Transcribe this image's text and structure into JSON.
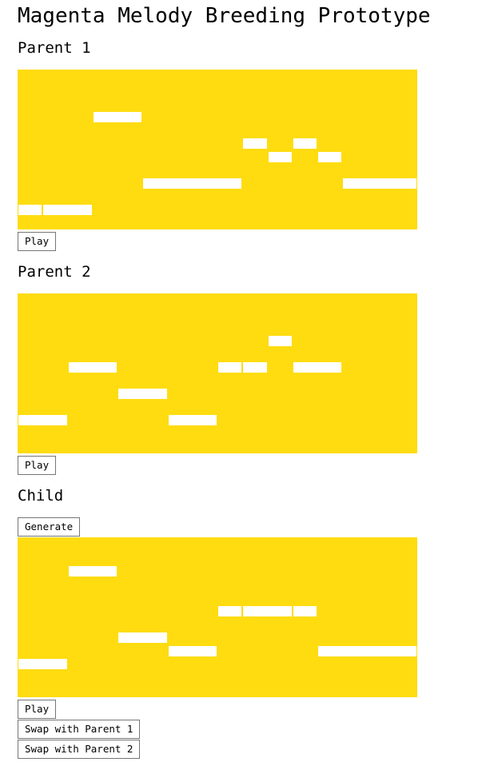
{
  "page": {
    "title": "Magenta Melody Breeding Prototype"
  },
  "sections": {
    "parent1": {
      "heading": "Parent 1",
      "play_label": "Play"
    },
    "parent2": {
      "heading": "Parent 2",
      "play_label": "Play"
    },
    "child": {
      "heading": "Child",
      "generate_label": "Generate",
      "play_label": "Play",
      "swap1_label": "Swap with Parent 1",
      "swap2_label": "Swap with Parent 2"
    }
  },
  "colors": {
    "roll_background": "#fedc10",
    "note": "#ffffff"
  },
  "melodies": {
    "note_grid": {
      "steps": 16,
      "lowest_pitch_row": 11
    },
    "parent1": [
      {
        "start": 0,
        "duration": 1,
        "row": 0
      },
      {
        "start": 1,
        "duration": 2,
        "row": 0
      },
      {
        "start": 3,
        "duration": 2,
        "row": 7
      },
      {
        "start": 5,
        "duration": 4,
        "row": 2
      },
      {
        "start": 9,
        "duration": 1,
        "row": 5
      },
      {
        "start": 10,
        "duration": 1,
        "row": 4
      },
      {
        "start": 11,
        "duration": 1,
        "row": 5
      },
      {
        "start": 12,
        "duration": 1,
        "row": 4
      },
      {
        "start": 13,
        "duration": 3,
        "row": 2
      }
    ],
    "parent2": [
      {
        "start": 0,
        "duration": 2,
        "row": 1
      },
      {
        "start": 2,
        "duration": 2,
        "row": 5
      },
      {
        "start": 4,
        "duration": 2,
        "row": 3
      },
      {
        "start": 6,
        "duration": 2,
        "row": 1
      },
      {
        "start": 8,
        "duration": 1,
        "row": 5
      },
      {
        "start": 9,
        "duration": 1,
        "row": 5
      },
      {
        "start": 10,
        "duration": 1,
        "row": 7
      },
      {
        "start": 11,
        "duration": 2,
        "row": 5
      }
    ],
    "child": [
      {
        "start": 0,
        "duration": 2,
        "row": 1
      },
      {
        "start": 2,
        "duration": 2,
        "row": 8
      },
      {
        "start": 4,
        "duration": 2,
        "row": 3
      },
      {
        "start": 6,
        "duration": 2,
        "row": 2
      },
      {
        "start": 8,
        "duration": 1,
        "row": 5
      },
      {
        "start": 9,
        "duration": 2,
        "row": 5
      },
      {
        "start": 11,
        "duration": 1,
        "row": 5
      },
      {
        "start": 12,
        "duration": 4,
        "row": 2
      }
    ]
  }
}
